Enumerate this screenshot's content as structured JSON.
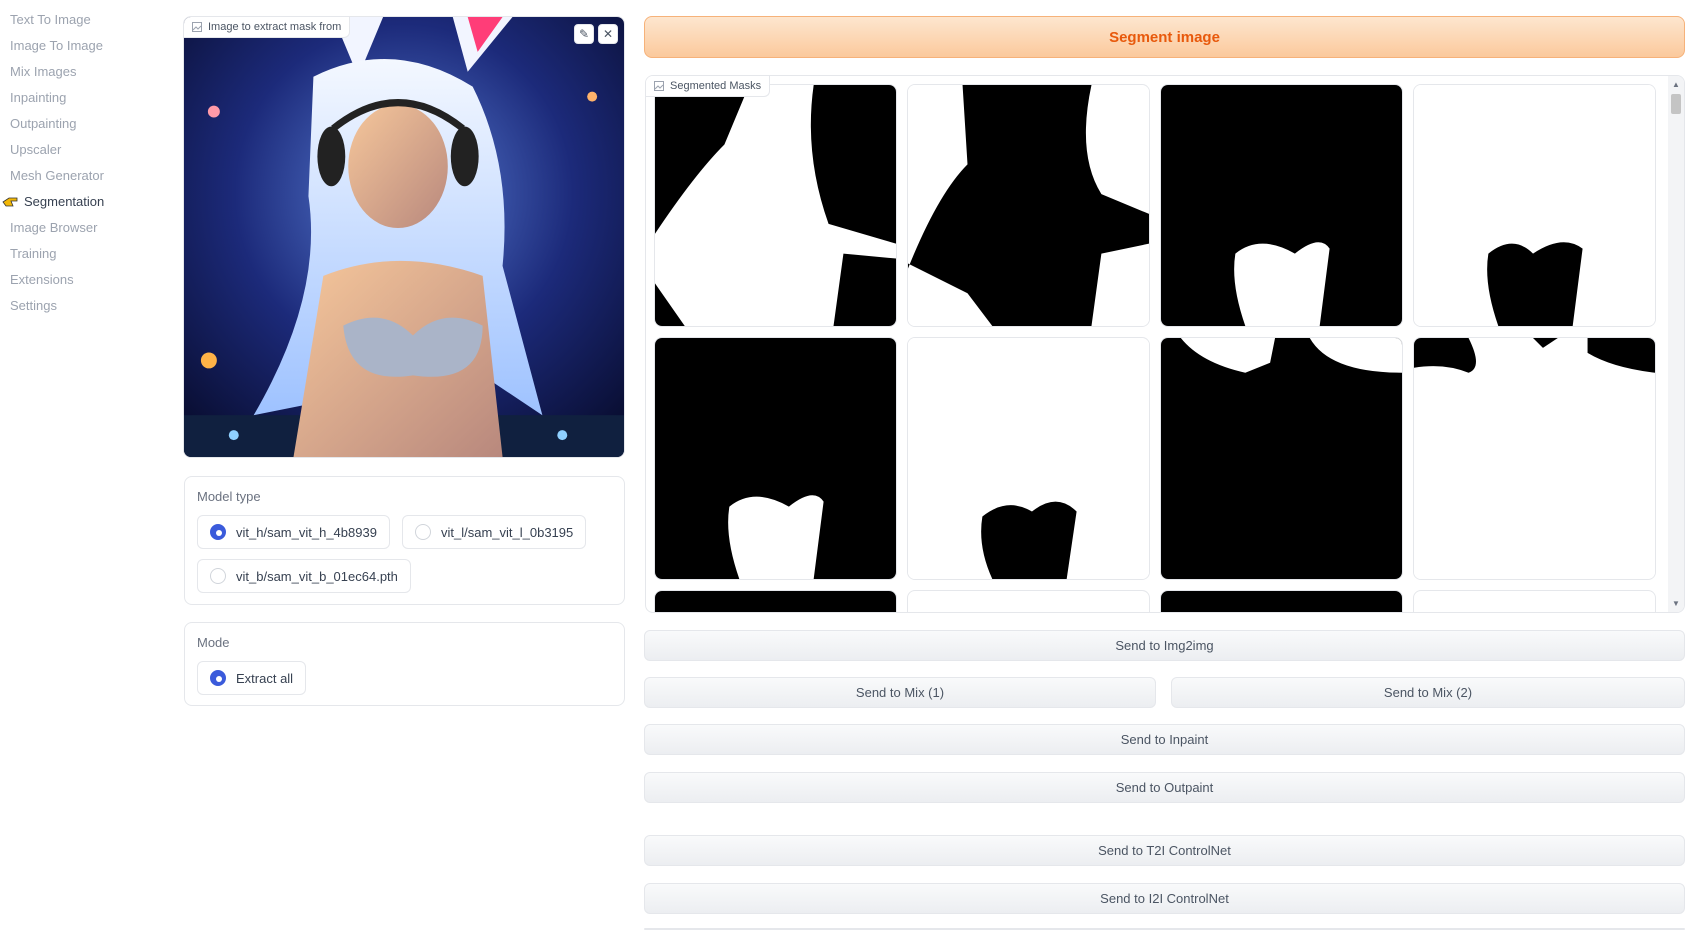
{
  "sidebar": {
    "items": [
      {
        "label": "Text To Image",
        "active": false
      },
      {
        "label": "Image To Image",
        "active": false
      },
      {
        "label": "Mix Images",
        "active": false
      },
      {
        "label": "Inpainting",
        "active": false
      },
      {
        "label": "Outpainting",
        "active": false
      },
      {
        "label": "Upscaler",
        "active": false
      },
      {
        "label": "Mesh Generator",
        "active": false
      },
      {
        "label": "Segmentation",
        "active": true,
        "icon": "pointing-hand-icon"
      },
      {
        "label": "Image Browser",
        "active": false
      },
      {
        "label": "Training",
        "active": false
      },
      {
        "label": "Extensions",
        "active": false
      },
      {
        "label": "Settings",
        "active": false
      }
    ]
  },
  "input_image": {
    "label": "Image to extract mask from",
    "edit_icon": "pencil-icon",
    "close_icon": "close-icon"
  },
  "model_type": {
    "title": "Model type",
    "options": [
      {
        "label": "vit_h/sam_vit_h_4b8939",
        "selected": true
      },
      {
        "label": "vit_l/sam_vit_l_0b3195",
        "selected": false
      },
      {
        "label": "vit_b/sam_vit_b_01ec64.pth",
        "selected": false
      }
    ]
  },
  "mode": {
    "title": "Mode",
    "options": [
      {
        "label": "Extract all",
        "selected": true
      }
    ]
  },
  "segment_button": {
    "label": "Segment image"
  },
  "gallery": {
    "label": "Segmented Masks"
  },
  "actions": {
    "send_img2img": "Send to Img2img",
    "send_mix1": "Send to Mix (1)",
    "send_mix2": "Send to Mix (2)",
    "send_inpaint": "Send to Inpaint",
    "send_outpaint": "Send to Outpaint",
    "send_t2i_controlnet": "Send to T2I ControlNet",
    "send_i2i_controlnet": "Send to I2I ControlNet"
  },
  "colors": {
    "accent": "#e8590c",
    "radio_selected": "#3b5bdb"
  }
}
